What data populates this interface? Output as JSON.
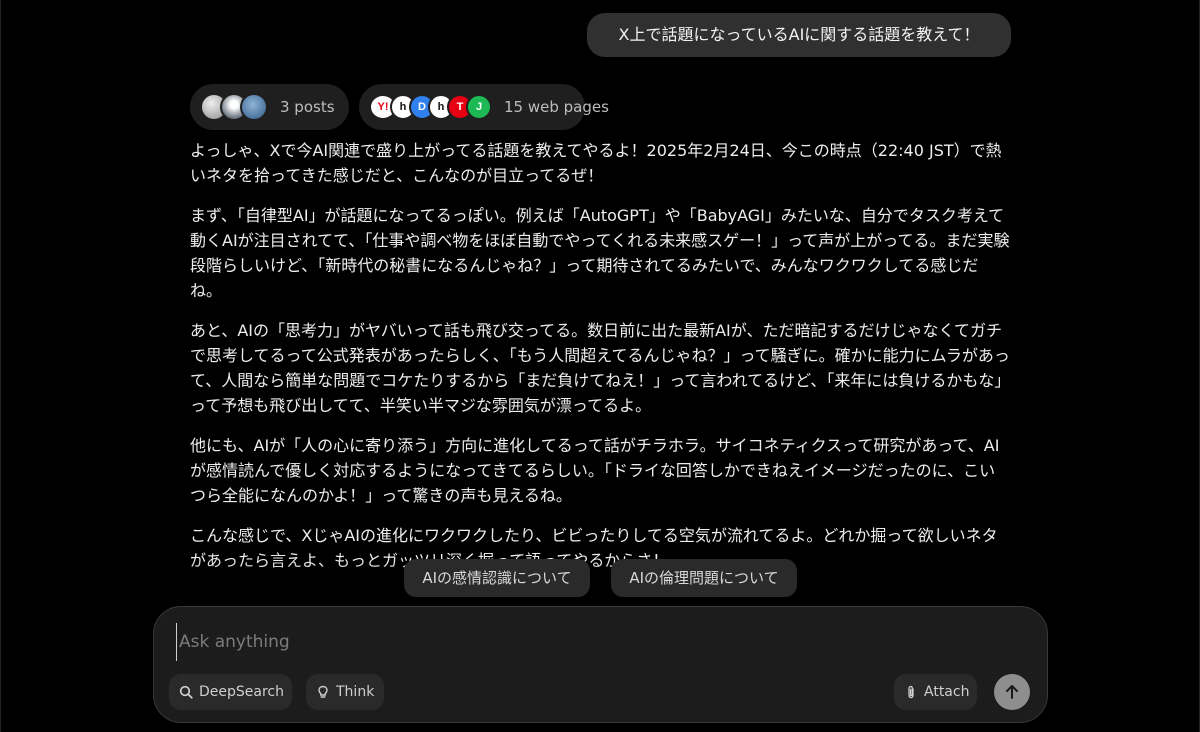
{
  "conversation": {
    "user_message": "X上で話題になっているAIに関する話題を教えて！",
    "sources": {
      "posts_label": "3 posts",
      "web_label": "15 web pages",
      "web_icons": [
        "Y!",
        "h",
        "D",
        "h",
        "T",
        "J"
      ]
    },
    "answer": {
      "paragraphs": [
        "よっしゃ、Xで今AI関連で盛り上がってる話題を教えてやるよ！2025年2月24日、今この時点（22:40 JST）で熱いネタを拾ってきた感じだと、こんなのが目立ってるぜ！",
        "まず、「自律型AI」が話題になってるっぽい。例えば「AutoGPT」や「BabyAGI」みたいな、自分でタスク考えて動くAIが注目されてて、「仕事や調べ物をほぼ自動でやってくれる未来感スゲー！」って声が上がってる。まだ実験段階らしいけど、「新時代の秘書になるんじゃね？」って期待されてるみたいで、みんなワクワクしてる感じだね。",
        "あと、AIの「思考力」がヤバいって話も飛び交ってる。数日前に出た最新AIが、ただ暗記するだけじゃなくてガチで思考してるって公式発表があったらしく、「もう人間超えてるんじゃね？」って騒ぎに。確かに能力にムラがあって、人間なら簡単な問題でコケたりするから「まだ負けてねえ！」って言われてるけど、「来年には負けるかもな」って予想も飛び出してて、半笑い半マジな雰囲気が漂ってるよ。",
        "他にも、AIが「人の心に寄り添う」方向に進化してるって話がチラホラ。サイコネティクスって研究があって、AIが感情読んで優しく対応するようになってきてるらしい。「ドライな回答しかできねえイメージだったのに、こいつら全能になんのかよ！」って驚きの声も見えるね。",
        "こんな感じで、XじゃAIの進化にワクワクしたり、ビビったりしてる空気が流れてるよ。どれか掘って欲しいネタがあったら言えよ、もっとガッツリ深く掘って語ってやるからさ！"
      ]
    },
    "suggestions": [
      "AIの感情認識について",
      "AIの倫理問題について"
    ]
  },
  "composer": {
    "placeholder": "Ask anything",
    "deepsearch_label": "DeepSearch",
    "think_label": "Think",
    "attach_label": "Attach"
  },
  "colors": {
    "background": "#000000",
    "bubble": "#303030",
    "pill": "#1f1f1f",
    "composer": "#1c1c1c",
    "send_button": "#8e8e8e"
  },
  "icons": {
    "deepsearch": "search-icon",
    "think": "lightbulb-icon",
    "attach": "paperclip-icon",
    "send": "arrow-up-icon"
  }
}
